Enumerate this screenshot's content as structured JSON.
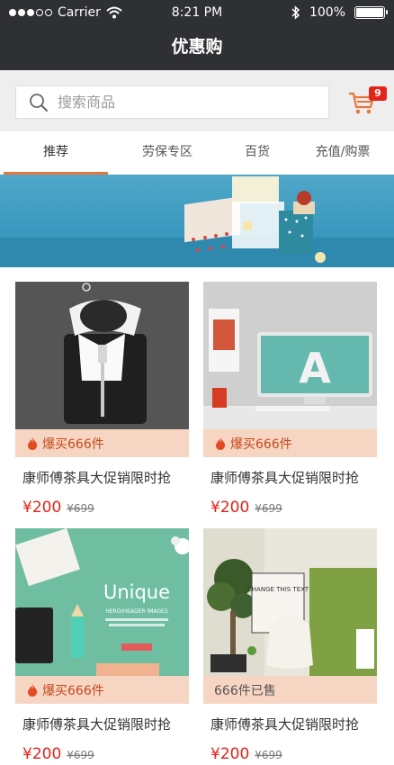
{
  "status_bar": {
    "carrier": "Carrier",
    "time": "8:21 PM",
    "battery": "100%"
  },
  "header": {
    "title": "优惠购"
  },
  "search": {
    "placeholder": "搜索商品"
  },
  "cart": {
    "badge": "9"
  },
  "tabs": [
    {
      "label": "推荐",
      "active": true
    },
    {
      "label": "劳保专区",
      "active": false
    },
    {
      "label": "百货",
      "active": false
    },
    {
      "label": "充值/购票",
      "active": false
    }
  ],
  "colors": {
    "dark": "#2f3033",
    "accent": "#e8763a",
    "price": "#e2231a",
    "tag_bg": "#f7d5c3",
    "tag_text": "#c24a1e"
  },
  "products": [
    {
      "image": "plate-cutlery",
      "tag": "爆买666件",
      "tag_icon": "fire-icon",
      "title": "康师傅茶具大促销限时抢",
      "price": "¥200",
      "original_price": "¥699"
    },
    {
      "image": "desk-monitor",
      "tag": "爆买666件",
      "tag_icon": "fire-icon",
      "title": "康师傅茶具大促销限时抢",
      "price": "¥200",
      "original_price": "¥699"
    },
    {
      "image": "unique-stationery",
      "tag": "爆买666件",
      "tag_icon": "fire-icon",
      "title": "康师傅茶具大促销限时抢",
      "price": "¥200",
      "original_price": "¥699",
      "image_text": "Unique",
      "image_subtext": "HERO/HEADER IMAGES"
    },
    {
      "image": "change-text-bag",
      "tag": "666件已售",
      "tag_icon": "",
      "title": "康师傅茶具大促销限时抢",
      "price": "¥200",
      "original_price": "¥699",
      "image_text": "CHANGE THIS TEXT"
    }
  ]
}
